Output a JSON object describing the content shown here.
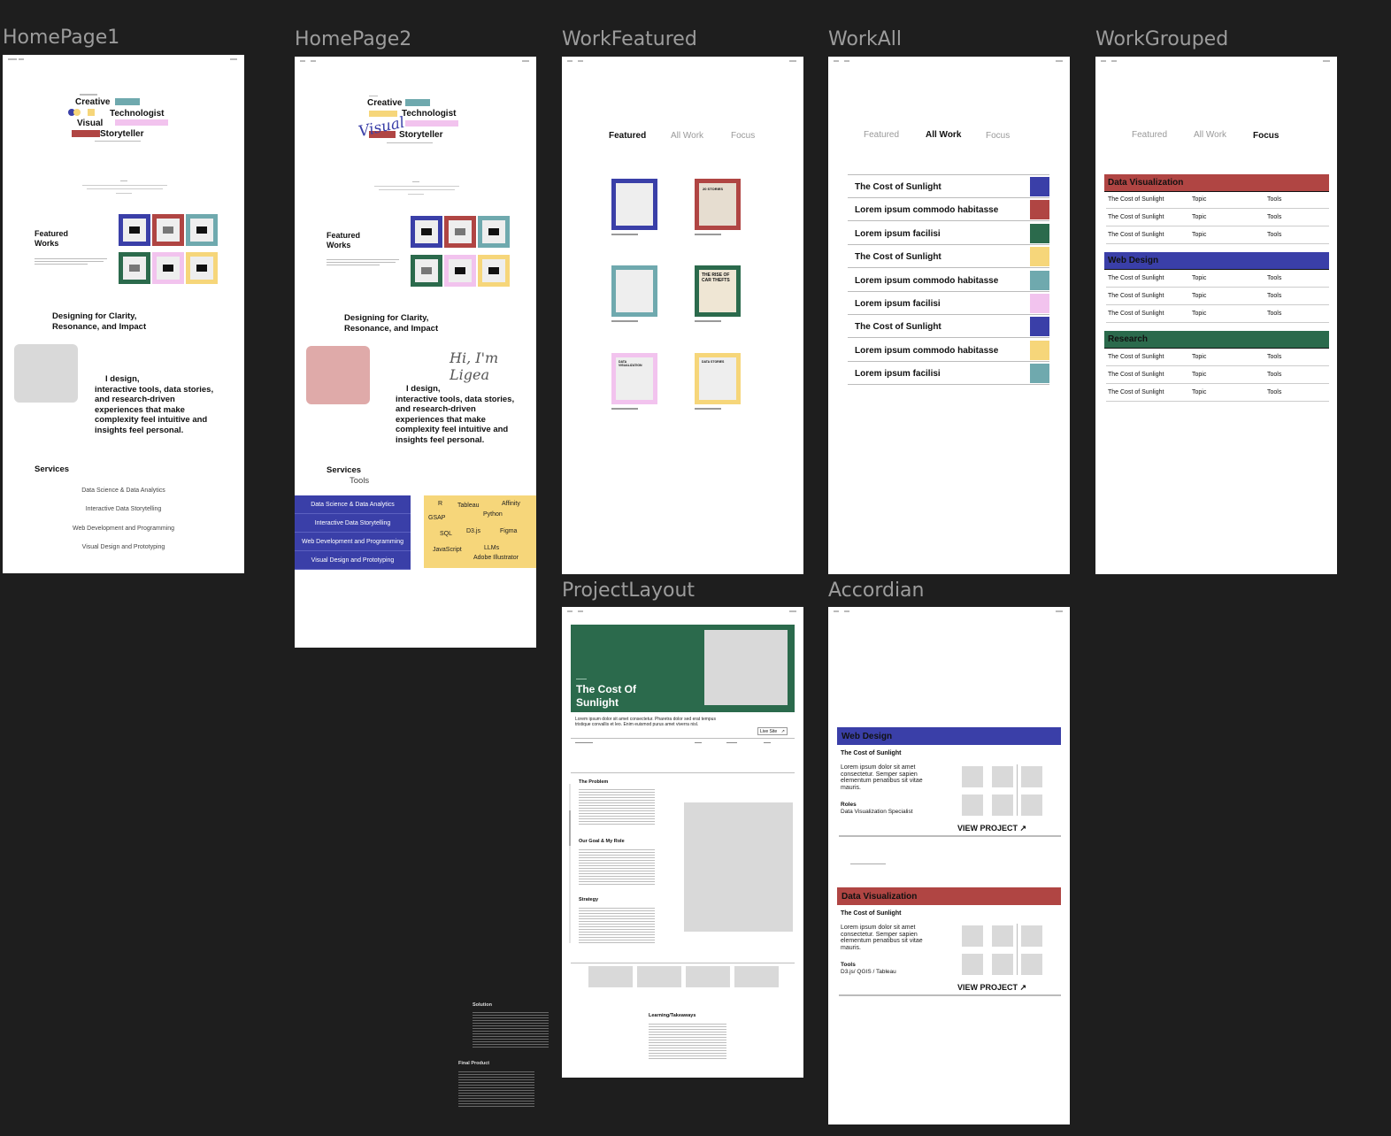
{
  "frames": {
    "home1": "HomePage1",
    "home2": "HomePage2",
    "work_featured": "WorkFeatured",
    "work_all": "WorkAll",
    "work_grouped": "WorkGrouped",
    "project_layout": "ProjectLayout",
    "accordian": "Accordian"
  },
  "colors": {
    "blue": "#3a3fa8",
    "red": "#b04543",
    "teal": "#6fa9ae",
    "green": "#2b6a4c",
    "yellow": "#f6d67a",
    "pink": "#f2c3ee",
    "grey": "#d9d9d9"
  },
  "hero": {
    "creative": "Creative",
    "technologist": "Technologist",
    "visual": "Visual",
    "storyteller": "Storyteller"
  },
  "home": {
    "featured_title_1": "Featured",
    "featured_title_2": "Works",
    "designing_1": "Designing for Clarity,",
    "designing_2": "Resonance, and Impact",
    "i_design_1": "I design,",
    "i_design_2": "interactive tools, data stories,",
    "i_design_3": "and research-driven",
    "i_design_4": "experiences that make",
    "i_design_5": "complexity feel intuitive and",
    "i_design_6": "insights feel personal.",
    "services_title": "Services",
    "tools_title": "Tools",
    "hi": "Hi, I'm Ligea",
    "services": [
      "Data Science & Data Analytics",
      "Interactive Data Storytelling",
      "Web Development and Programming",
      "Visual Design and Prototyping"
    ],
    "tools": [
      "R",
      "Tableau",
      "Affinity",
      "GSAP",
      "Python",
      "SQL",
      "D3.js",
      "Figma",
      "JavaScript",
      "LLMs",
      "Adobe Illustrator"
    ]
  },
  "tabs": {
    "featured": "Featured",
    "all_work": "All Work",
    "focus": "Focus"
  },
  "work_all_rows": [
    "The Cost of Sunlight",
    "Lorem ipsum commodo habitasse",
    "Lorem ipsum facilisi",
    "The Cost of Sunlight",
    "Lorem ipsum commodo habitasse",
    "Lorem ipsum facilisi",
    "The Cost of Sunlight",
    "Lorem ipsum commodo habitasse",
    "Lorem ipsum facilisi"
  ],
  "work_featured_posters": {
    "p2": "20 STORIES",
    "p4_1": "THE RISE OF",
    "p4_2": "CAR THEFTS",
    "p5": "DATA VISUALIZATION",
    "p6": "DATA STORIES"
  },
  "grouped": {
    "groups": [
      "Data Visualization",
      "Web Design",
      "Research"
    ],
    "row_title": "The Cost of Sunlight",
    "row_topic": "Topic",
    "row_tools": "Tools"
  },
  "project": {
    "title_1": "The Cost Of",
    "title_2": "Sunlight",
    "intro": "Lorem ipsum dolor sit amet consectetur. Pharetra dolor sed erat tempus tristique convallis et leo. Enim euismod purus amet viverra nisl.",
    "live_site": "Live Site",
    "problem": "The Problem",
    "goal": "Our Goal & My Role",
    "strategy": "Strategy",
    "solution": "Solution",
    "final_product": "Final Product",
    "learning": "Learning/Takeaways"
  },
  "accordian": {
    "web_design": "Web Design",
    "data_viz": "Data Visualization",
    "cost": "The Cost of Sunlight",
    "lorem_1": "Lorem ipsum dolor sit amet",
    "lorem_2": "consectetur. Semper sapien",
    "lorem_3": "elementum penatibus sit vitae",
    "lorem_4": "mauris.",
    "roles": "Roles",
    "roles_val": "Data Visualization Specialist",
    "tools": "Tools",
    "tools_val": "D3.js/ QGIS / Tableau",
    "view": "VIEW PROJECT ↗"
  }
}
